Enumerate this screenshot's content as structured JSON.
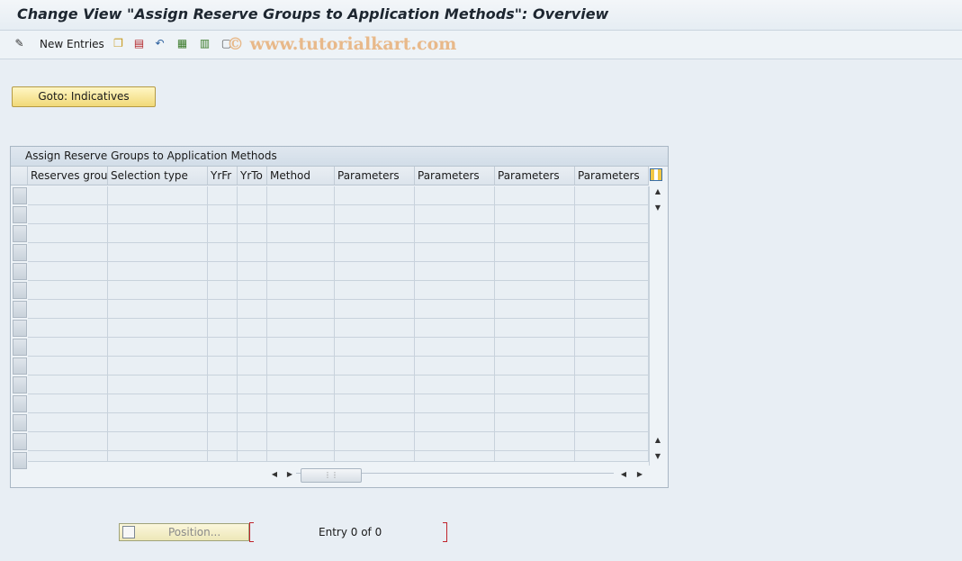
{
  "window": {
    "title": "Change View \"Assign Reserve Groups to Application Methods\": Overview"
  },
  "toolbar": {
    "new_entries_label": "New Entries",
    "watermark": "© www.tutorialkart.com"
  },
  "buttons": {
    "goto_indicatives": "Goto: Indicatives",
    "position": "Position..."
  },
  "table": {
    "title": "Assign Reserve Groups to Application Methods",
    "columns": [
      "Reserves group",
      "Selection type",
      "YrFr",
      "YrTo",
      "Method",
      "Parameters",
      "Parameters",
      "Parameters",
      "Parameters"
    ],
    "row_count": 15
  },
  "status": {
    "entry_text": "Entry 0 of 0"
  },
  "icons": [
    "pen-icon",
    "copy-icon",
    "delete-icon",
    "undo-icon",
    "select-all-icon",
    "select-block-icon",
    "deselect-icon",
    "table-settings-icon",
    "scroll-up-icon",
    "scroll-down-icon",
    "scroll-left-icon",
    "scroll-right-icon",
    "position-icon"
  ],
  "colors": {
    "accent_button": "#f1d978",
    "background": "#e8eef4",
    "bracket": "#c0242c"
  }
}
